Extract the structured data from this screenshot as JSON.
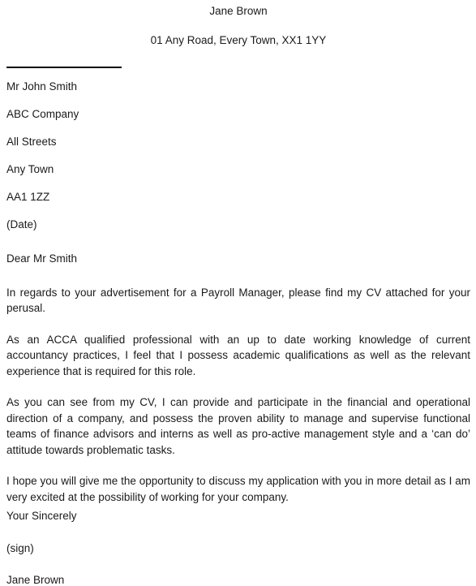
{
  "document": {
    "type": "cover-letter",
    "text_color": "#1a1a1a",
    "background_color": "#ffffff",
    "rule_color": "#000000"
  },
  "letterhead": {
    "sender_name": "Jane Brown",
    "sender_address": "01 Any Road, Every Town, XX1 1YY"
  },
  "recipient": {
    "lines": [
      "Mr John Smith",
      "ABC Company",
      "All Streets",
      "Any Town",
      "AA1 1ZZ",
      "(Date)"
    ]
  },
  "salutation": "Dear Mr Smith",
  "body": {
    "paragraphs": [
      "In regards to your advertisement for a Payroll Manager, please find my CV attached for your perusal.",
      "As an ACCA qualified professional with an up to date working knowledge of current accountancy practices, I feel that I possess academic qualifications as well as the relevant experience that is required for this role.",
      "As you can see from my CV, I can provide and participate in the financial and operational direction of a company, and possess the proven ability to manage and supervise functional teams of finance advisors and interns as well as pro-active management style and a ‘can do’ attitude towards problematic tasks.",
      "I hope you will give me the opportunity to discuss my application with you in more detail as I am very excited at the possibility of working for your company."
    ]
  },
  "closing": {
    "sign_off": "Your Sincerely",
    "signature_placeholder": "(sign)",
    "sender_name": "Jane Brown"
  }
}
